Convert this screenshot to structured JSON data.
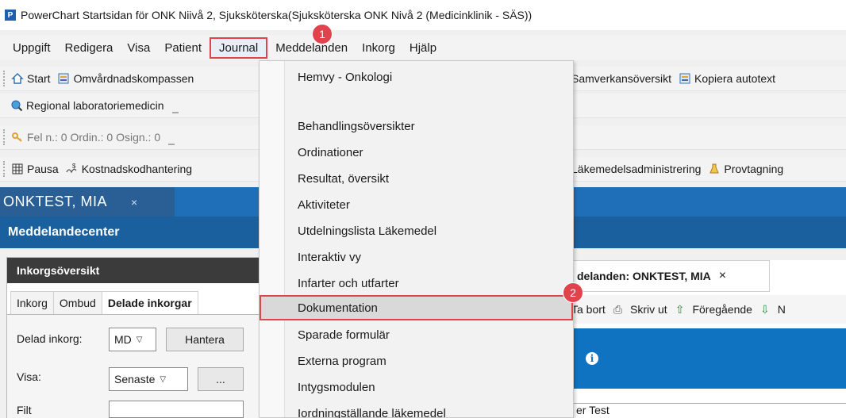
{
  "window": {
    "title": "PowerChart Startsidan för ONK Niivå 2, Sjuksköterska(Sjuksköterska ONK Nivå 2 (Medicinklinik - SÄS))"
  },
  "menubar": {
    "items": [
      "Uppgift",
      "Redigera",
      "Visa",
      "Patient",
      "Journal",
      "Meddelanden",
      "Inkorg",
      "Hjälp"
    ],
    "active": "Journal"
  },
  "toolbar1": {
    "left": [
      "Start",
      "Omvårdnadskompassen"
    ],
    "right": [
      "Samverkansöversikt",
      "Kopiera autotext"
    ]
  },
  "toolbar2": {
    "items": [
      "Regional laboratoriemedicin"
    ]
  },
  "toolbar3": {
    "fel": "Fel n.: 0",
    "ordin": "Ordin.: 0",
    "osign": "Osign.: 0"
  },
  "toolbar4": {
    "left": [
      "Pausa",
      "Kostnadskodhantering"
    ],
    "right": [
      "Läkemedelsadministrering",
      "Provtagning"
    ]
  },
  "patient_tab": {
    "name": "ONKTEST, MIA",
    "close": "×"
  },
  "center_title": "Meddelandecenter",
  "inbox_panel": {
    "header": "Inkorgsöversikt",
    "tabs": [
      "Inkorg",
      "Ombud",
      "Delade inkorgar"
    ],
    "delad_label": "Delad inkorg:",
    "delad_value": "MD",
    "hantera": "Hantera",
    "visa_label": "Visa:",
    "visa_value": "Senaste",
    "more": "...",
    "filter_label": "Filt"
  },
  "messages_panel": {
    "tab": "delanden: ONKTEST, MIA",
    "close": "×",
    "toolbar": [
      "Ta bort",
      "Skriv ut",
      "Föregående",
      "N"
    ],
    "bottom_text": "er Test"
  },
  "journal_menu": {
    "items": [
      "Hemvy - Onkologi",
      "",
      "Behandlingsöversikter",
      "Ordinationer",
      "Resultat, översikt",
      "Aktiviteter",
      "Utdelningslista Läkemedel",
      "Interaktiv vy",
      "Infarter och utfarter",
      "Dokumentation",
      "Sparade formulär",
      "Externa program",
      "Intygsmodulen",
      "Iordningställande läkemedel"
    ],
    "highlighted": "Dokumentation"
  },
  "badges": {
    "one": "1",
    "two": "2"
  },
  "colors": {
    "accent_red": "#e0434b",
    "header_blue": "#1f6fb8",
    "info_blue": "#0f73c2"
  }
}
